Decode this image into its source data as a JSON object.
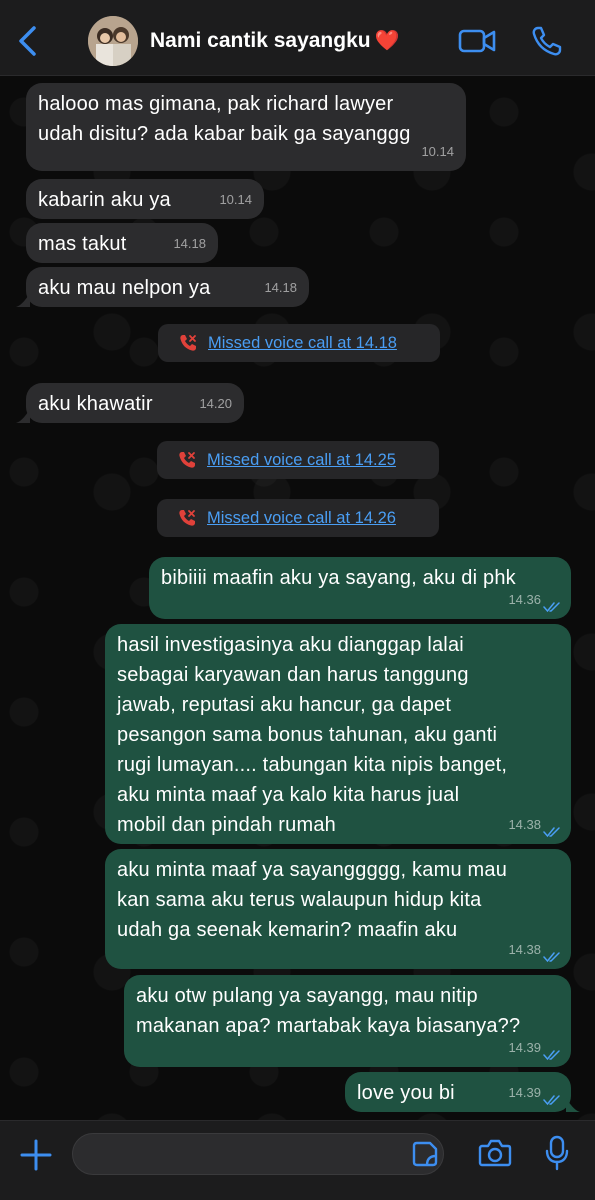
{
  "header": {
    "title": "Nami cantik sayangku",
    "title_emoji": "❤️"
  },
  "messages": [
    {
      "dir": "in",
      "text": "halooo mas gimana, pak richard lawyer\nudah disitu? ada kabar baik ga sayanggg",
      "time": "10.14"
    },
    {
      "dir": "in",
      "text": "kabarin aku ya",
      "time": "10.14"
    },
    {
      "dir": "in",
      "text": "mas takut",
      "time": "14.18"
    },
    {
      "dir": "in",
      "text": "aku mau nelpon ya",
      "time": "14.18"
    },
    {
      "dir": "in",
      "text": "aku khawatir",
      "time": "14.20"
    },
    {
      "dir": "out",
      "text": "bibiiii maafin aku ya sayang, aku di phk",
      "time": "14.36"
    },
    {
      "dir": "out",
      "text": "hasil investigasinya aku dianggap lalai\nsebagai karyawan dan harus tanggung\njawab, reputasi aku hancur, ga dapet\npesangon sama bonus tahunan, aku ganti\nrugi lumayan.... tabungan kita nipis banget,\naku minta maaf ya kalo kita harus jual\nmobil dan pindah rumah",
      "time": "14.38"
    },
    {
      "dir": "out",
      "text": "aku minta maaf ya sayanggggg, kamu mau\nkan sama aku terus walaupun hidup kita\nudah ga seenak kemarin? maafin aku",
      "time": "14.38"
    },
    {
      "dir": "out",
      "text": "aku otw pulang ya sayangg, mau nitip\nmakanan apa? martabak kaya biasanya??",
      "time": "14.39"
    },
    {
      "dir": "out",
      "text": "love you bi",
      "time": "14.39"
    }
  ],
  "missed_calls": [
    {
      "label": "Missed voice call at 14.18"
    },
    {
      "label": "Missed voice call at 14.25"
    },
    {
      "label": "Missed voice call at 14.26"
    }
  ],
  "colors": {
    "incoming_bubble": "#2c2c2e",
    "outgoing_bubble": "#1f5241",
    "accent": "#3d8ef0",
    "missed_call": "#e0413a"
  },
  "icons": {
    "back": "chevron-left-icon",
    "video": "video-camera-icon",
    "call": "phone-icon",
    "plus": "plus-icon",
    "sticker": "sticker-icon",
    "camera": "camera-icon",
    "mic": "microphone-icon",
    "missed": "missed-call-icon",
    "read": "double-check-icon"
  }
}
